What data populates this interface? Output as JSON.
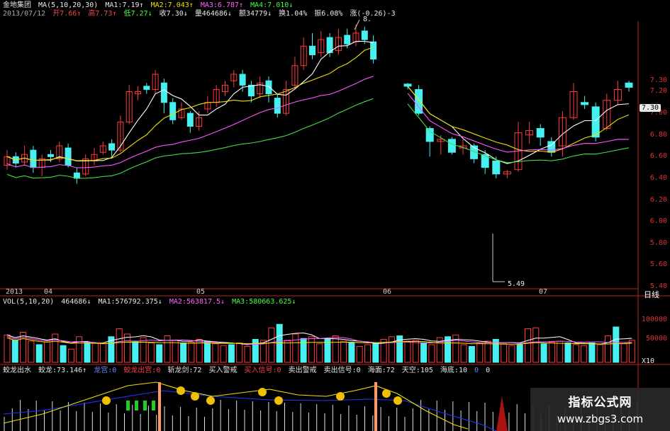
{
  "header": {
    "row1": {
      "name": "金地集团",
      "ma_label": "MA(5,10,20,30)",
      "ma1": "MA1:7.19↑",
      "ma2": "MA2:7.043↑",
      "ma3": "MA3:6.787↑",
      "ma4": "MA4:7.010↓"
    },
    "row2": {
      "date": "2013/07/12",
      "open": "开7.66↑",
      "high": "高7.73↑",
      "low": "低7.27↓",
      "close": "收7.30↓",
      "volume": "量464686↓",
      "amount": "额34779↓",
      "turnover": "换1.04%",
      "amplitude": "振6.08%",
      "change": "涨(-0.26)-3"
    }
  },
  "price_axis": [
    "7.30",
    "7.20",
    "7.00",
    "6.80",
    "6.60",
    "6.40",
    "6.20",
    "6.00",
    "5.80",
    "5.60",
    "5.40"
  ],
  "price_tag": "7.30",
  "peak_label": "8.",
  "low_label": "5.49",
  "date_axis": [
    "2013",
    "04",
    "05",
    "06",
    "07"
  ],
  "period_button": "日线",
  "vol_header": {
    "label": "VOL(5,10,20)",
    "v": "464686↓",
    "ma1": "MA1:576792.375↓",
    "ma2": "MA2:563817.5↓",
    "ma3": "MA3:580663.625↓"
  },
  "vol_axis": [
    "100000",
    "50000"
  ],
  "vol_unit": "X10",
  "indicator_header": {
    "name": "蛟龙出水",
    "jiaolong": "蛟龙:73.146↑",
    "longgong": "龙宫:0",
    "jiaolong_chugong": "蛟龙出宫:0",
    "zhanlongjian": "斩龙剑:72",
    "buy_warn": "买入警戒",
    "buy_signal": "买入信号:0",
    "sell_warn": "卖出警戒",
    "sell_signal": "卖出信号:0",
    "haimian": "海面:72",
    "tiankong": "天空:105",
    "haidi": "海底:10",
    "extra1": "0",
    "extra2": "0"
  },
  "watermark": {
    "title": "指标公式网",
    "url": "www.zbgs3.com"
  },
  "colors": {
    "up": "#ff3b3b",
    "down": "#46f0f0",
    "ma1": "#ffffff",
    "ma2": "#f0e000",
    "ma3": "#ff55ff",
    "ma4": "#44dd44"
  },
  "chart_data": {
    "type": "candlestick",
    "price_ylim": [
      5.4,
      7.3
    ],
    "candles_left": [
      {
        "o": 6.52,
        "c": 6.6,
        "h": 6.66,
        "l": 6.48
      },
      {
        "o": 6.6,
        "c": 6.54,
        "h": 6.64,
        "l": 6.5
      },
      {
        "o": 6.55,
        "c": 6.62,
        "h": 6.7,
        "l": 6.52
      },
      {
        "o": 6.66,
        "c": 6.5,
        "h": 6.7,
        "l": 6.45
      },
      {
        "o": 6.5,
        "c": 6.58,
        "h": 6.62,
        "l": 6.42
      },
      {
        "o": 6.62,
        "c": 6.6,
        "h": 6.66,
        "l": 6.55
      },
      {
        "o": 6.58,
        "c": 6.7,
        "h": 6.74,
        "l": 6.55
      },
      {
        "o": 6.68,
        "c": 6.52,
        "h": 6.72,
        "l": 6.5
      },
      {
        "o": 6.45,
        "c": 6.4,
        "h": 6.5,
        "l": 6.35
      },
      {
        "o": 6.44,
        "c": 6.58,
        "h": 6.62,
        "l": 6.42
      },
      {
        "o": 6.56,
        "c": 6.62,
        "h": 6.68,
        "l": 6.52
      },
      {
        "o": 6.64,
        "c": 6.7,
        "h": 6.74,
        "l": 6.62
      },
      {
        "o": 6.72,
        "c": 6.66,
        "h": 6.76,
        "l": 6.6
      },
      {
        "o": 6.66,
        "c": 6.92,
        "h": 6.98,
        "l": 6.64
      },
      {
        "o": 6.92,
        "c": 7.2,
        "h": 7.26,
        "l": 6.9
      },
      {
        "o": 7.18,
        "c": 7.2,
        "h": 7.25,
        "l": 7.12
      },
      {
        "o": 7.25,
        "c": 7.22,
        "h": 7.28,
        "l": 7.18
      },
      {
        "o": 7.22,
        "c": 7.36,
        "h": 7.4,
        "l": 7.18
      },
      {
        "o": 7.28,
        "c": 7.1,
        "h": 7.32,
        "l": 7.0
      },
      {
        "o": 7.1,
        "c": 6.94,
        "h": 7.14,
        "l": 6.9
      },
      {
        "o": 6.96,
        "c": 7.04,
        "h": 7.1,
        "l": 6.94
      },
      {
        "o": 7.0,
        "c": 6.88,
        "h": 7.02,
        "l": 6.82
      },
      {
        "o": 6.88,
        "c": 6.96,
        "h": 7.02,
        "l": 6.84
      },
      {
        "o": 7.04,
        "c": 7.1,
        "h": 7.16,
        "l": 7.0
      },
      {
        "o": 7.1,
        "c": 7.22,
        "h": 7.26,
        "l": 7.06
      },
      {
        "o": 7.2,
        "c": 7.26,
        "h": 7.3,
        "l": 7.16
      },
      {
        "o": 7.3,
        "c": 7.36,
        "h": 7.4,
        "l": 7.24
      },
      {
        "o": 7.36,
        "c": 7.26,
        "h": 7.4,
        "l": 7.2
      },
      {
        "o": 7.26,
        "c": 7.16,
        "h": 7.3,
        "l": 7.1
      },
      {
        "o": 7.18,
        "c": 7.28,
        "h": 7.34,
        "l": 7.14
      },
      {
        "o": 7.3,
        "c": 7.18,
        "h": 7.34,
        "l": 7.1
      },
      {
        "o": 7.14,
        "c": 7.0,
        "h": 7.18,
        "l": 6.96
      },
      {
        "o": 7.0,
        "c": 7.22,
        "h": 7.3,
        "l": 6.98
      },
      {
        "o": 7.26,
        "c": 7.44,
        "h": 7.52,
        "l": 7.22
      },
      {
        "o": 7.44,
        "c": 7.62,
        "h": 7.7,
        "l": 7.4
      },
      {
        "o": 7.62,
        "c": 7.54,
        "h": 7.74,
        "l": 7.5
      },
      {
        "o": 7.56,
        "c": 7.68,
        "h": 7.76,
        "l": 7.52
      },
      {
        "o": 7.7,
        "c": 7.56,
        "h": 7.74,
        "l": 7.52
      },
      {
        "o": 7.58,
        "c": 7.7,
        "h": 7.78,
        "l": 7.54
      },
      {
        "o": 7.72,
        "c": 7.64,
        "h": 7.78,
        "l": 7.6
      },
      {
        "o": 7.66,
        "c": 7.74,
        "h": 7.82,
        "l": 7.62
      },
      {
        "o": 7.76,
        "c": 7.68,
        "h": 7.8,
        "l": 7.64
      },
      {
        "o": 7.66,
        "c": 7.5,
        "h": 7.72,
        "l": 7.46
      }
    ],
    "candles_right": [
      {
        "o": 7.27,
        "c": 7.25,
        "h": 7.28,
        "l": 7.22
      },
      {
        "o": 7.22,
        "c": 7.0,
        "h": 7.26,
        "l": 6.98
      },
      {
        "o": 6.86,
        "c": 6.74,
        "h": 6.88,
        "l": 6.6
      },
      {
        "o": 6.74,
        "c": 6.76,
        "h": 6.8,
        "l": 6.62
      },
      {
        "o": 6.76,
        "c": 6.64,
        "h": 6.78,
        "l": 6.62
      },
      {
        "o": 6.68,
        "c": 6.7,
        "h": 6.76,
        "l": 6.62
      },
      {
        "o": 6.7,
        "c": 6.58,
        "h": 6.72,
        "l": 6.54
      },
      {
        "o": 6.62,
        "c": 6.5,
        "h": 6.66,
        "l": 6.44
      },
      {
        "o": 6.56,
        "c": 6.44,
        "h": 6.6,
        "l": 6.4
      },
      {
        "o": 6.44,
        "c": 6.46,
        "h": 6.48,
        "l": 6.4
      },
      {
        "o": 6.48,
        "c": 6.82,
        "h": 6.92,
        "l": 6.46
      },
      {
        "o": 6.8,
        "c": 6.84,
        "h": 6.92,
        "l": 6.72
      },
      {
        "o": 6.86,
        "c": 6.78,
        "h": 6.9,
        "l": 6.7
      },
      {
        "o": 6.74,
        "c": 6.64,
        "h": 6.78,
        "l": 6.6
      },
      {
        "o": 6.7,
        "c": 6.96,
        "h": 7.02,
        "l": 6.6
      },
      {
        "o": 6.96,
        "c": 7.2,
        "h": 7.28,
        "l": 6.94
      },
      {
        "o": 7.1,
        "c": 7.08,
        "h": 7.16,
        "l": 7.04
      },
      {
        "o": 7.06,
        "c": 6.78,
        "h": 7.1,
        "l": 6.74
      },
      {
        "o": 6.86,
        "c": 7.12,
        "h": 7.18,
        "l": 6.84
      },
      {
        "o": 7.12,
        "c": 7.22,
        "h": 7.3,
        "l": 7.08
      },
      {
        "o": 7.28,
        "c": 7.24,
        "h": 7.3,
        "l": 7.2
      }
    ],
    "volume": [
      62,
      50,
      68,
      48,
      40,
      46,
      64,
      38,
      30,
      58,
      46,
      44,
      42,
      58,
      76,
      64,
      48,
      56,
      44,
      40,
      60,
      50,
      44,
      46,
      52,
      48,
      42,
      38,
      40,
      44,
      36,
      52,
      50,
      78,
      86,
      50,
      64,
      54,
      58,
      42,
      52,
      60,
      48,
      44,
      36,
      40,
      44,
      52,
      58,
      60,
      48,
      50,
      44,
      40,
      56,
      58,
      62,
      40,
      36,
      44,
      48,
      52,
      42,
      38,
      40,
      76,
      78,
      42,
      46,
      48,
      44,
      40,
      38,
      44,
      40,
      60,
      80,
      42,
      50
    ],
    "volume_ylim": [
      0,
      120000
    ]
  }
}
